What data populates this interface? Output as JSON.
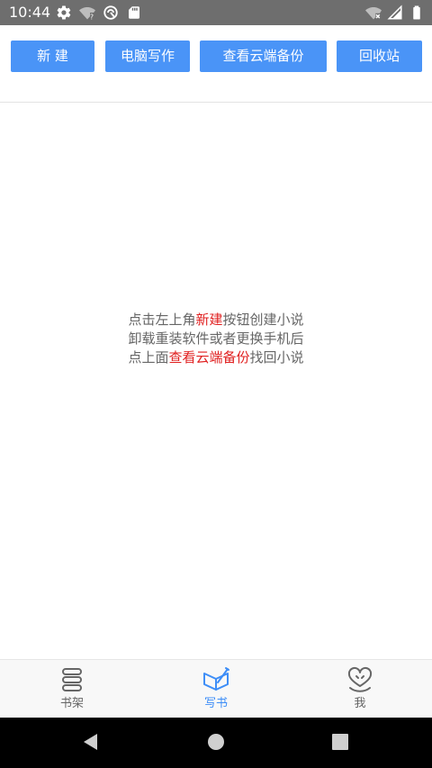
{
  "status_bar": {
    "time": "10:44",
    "left_icons": [
      "gear-icon",
      "wifi-question-icon",
      "vpn-icon",
      "sd-card-icon"
    ],
    "right_icons": [
      "wifi-x-icon",
      "signal-icon",
      "battery-icon"
    ]
  },
  "toolbar": {
    "new_label": "新 建",
    "pc_write_label": "电脑写作",
    "cloud_backup_label": "查看云端备份",
    "recycle_bin_label": "回收站"
  },
  "hint": {
    "line1_pre": "点击左上角",
    "line1_highlight": "新建",
    "line1_post": "按钮创建小说",
    "line2": "卸载重装软件或者更换手机后",
    "line3_pre": "点上面",
    "line3_highlight": "查看云端备份",
    "line3_post": "找回小说",
    "highlight_color": "#e02020"
  },
  "bottom_nav": {
    "items": [
      {
        "label": "书架",
        "icon": "bookshelf-icon",
        "active": false
      },
      {
        "label": "写书",
        "icon": "pen-book-icon",
        "active": true
      },
      {
        "label": "我",
        "icon": "heart-smile-icon",
        "active": false
      }
    ],
    "active_color": "#3e8ef7"
  },
  "system_nav": {
    "buttons": [
      "back-icon",
      "home-icon",
      "recents-icon"
    ]
  },
  "colors": {
    "accent": "#4a94f7",
    "status_bar": "#6e6e6e"
  }
}
